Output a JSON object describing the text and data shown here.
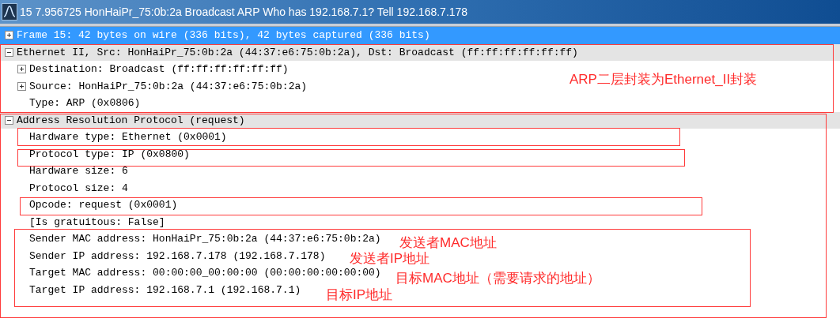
{
  "window": {
    "title": "15 7.956725 HonHaiPr_75:0b:2a Broadcast ARP Who has 192.168.7.1?  Tell 192.168.7.178"
  },
  "tree": [
    {
      "label": "Frame 15: 42 bytes on wire (336 bits), 42 bytes captured (336 bits)",
      "expanded": false,
      "selected": true
    },
    {
      "label": "Ethernet II, Src: HonHaiPr_75:0b:2a (44:37:e6:75:0b:2a), Dst: Broadcast (ff:ff:ff:ff:ff:ff)",
      "expanded": true,
      "selected": false,
      "children": [
        {
          "label": "Destination: Broadcast (ff:ff:ff:ff:ff:ff)",
          "expanded": false,
          "selected": false
        },
        {
          "label": "Source: HonHaiPr_75:0b:2a (44:37:e6:75:0b:2a)",
          "expanded": false,
          "selected": false
        },
        {
          "label": "Type: ARP (0x0806)",
          "selected": false
        }
      ]
    },
    {
      "label": "Address Resolution Protocol (request)",
      "expanded": true,
      "selected": false,
      "children": [
        {
          "label": "Hardware type: Ethernet (0x0001)",
          "selected": false
        },
        {
          "label": "Protocol type: IP (0x0800)",
          "selected": false
        },
        {
          "label": "Hardware size: 6",
          "selected": false
        },
        {
          "label": "Protocol size: 4",
          "selected": false
        },
        {
          "label": "Opcode: request (0x0001)",
          "selected": false
        },
        {
          "label": "[Is gratuitous: False]",
          "selected": false
        },
        {
          "label": "Sender MAC address: HonHaiPr_75:0b:2a (44:37:e6:75:0b:2a)",
          "selected": false
        },
        {
          "label": "Sender IP address: 192.168.7.178 (192.168.7.178)",
          "selected": false
        },
        {
          "label": "Target MAC address: 00:00:00_00:00:00 (00:00:00:00:00:00)",
          "selected": false
        },
        {
          "label": "Target IP address: 192.168.7.1 (192.168.7.1)",
          "selected": false
        }
      ]
    }
  ],
  "annotations": [
    {
      "text": "ARP二层封装为Ethernet_II封装"
    },
    {
      "text": "发送者MAC地址"
    },
    {
      "text": "发送者IP地址"
    },
    {
      "text": "目标MAC地址（需要请求的地址）"
    },
    {
      "text": "目标IP地址"
    }
  ]
}
